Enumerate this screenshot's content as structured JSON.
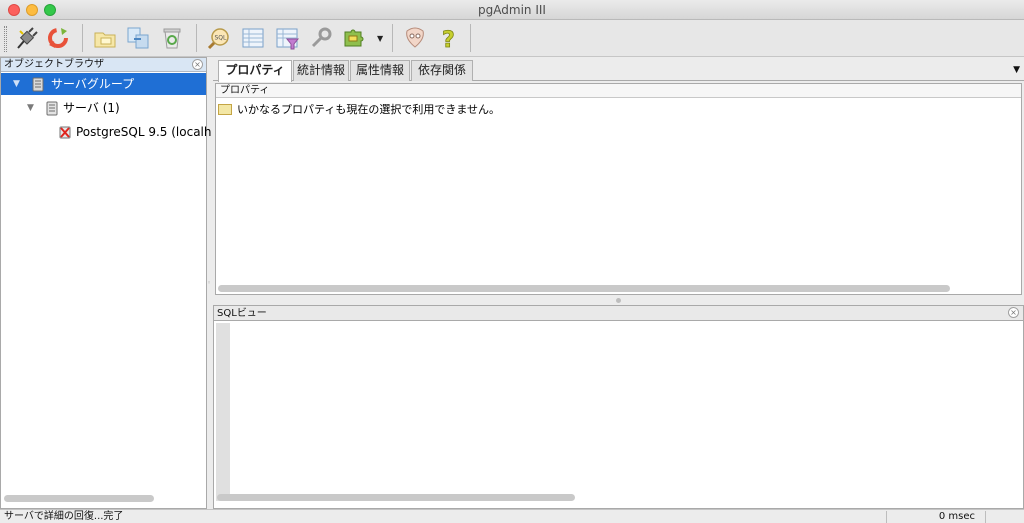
{
  "window": {
    "title": "pgAdmin III"
  },
  "toolbar": {
    "buttons": [
      {
        "icon": "connect-plug-icon"
      },
      {
        "icon": "refresh-icon"
      },
      {
        "icon": "properties-folder-icon"
      },
      {
        "icon": "create-object-icon"
      },
      {
        "icon": "drop-object-recycle-icon"
      },
      {
        "icon": "sql-query-icon"
      },
      {
        "icon": "view-data-grid-icon"
      },
      {
        "icon": "filtered-data-icon"
      },
      {
        "icon": "maintenance-wrench-icon"
      },
      {
        "icon": "plugins-puzzle-icon"
      },
      {
        "icon": "tips-icon"
      },
      {
        "icon": "help-question-icon"
      }
    ]
  },
  "object_browser": {
    "title": "オブジェクトブラウザ",
    "tree": [
      {
        "label": "サーバグループ",
        "icon": "server-group-icon",
        "selected": true
      },
      {
        "label": "サーバ (1)",
        "icon": "servers-icon",
        "selected": false
      },
      {
        "label": "PostgreSQL 9.5 (localh",
        "icon": "disconnected-server-icon",
        "selected": false
      }
    ]
  },
  "tabs": [
    {
      "label": "プロパティ",
      "active": true
    },
    {
      "label": "統計情報",
      "active": false
    },
    {
      "label": "属性情報",
      "active": false
    },
    {
      "label": "依存関係",
      "active": false
    }
  ],
  "properties": {
    "column_header": "プロパティ",
    "message": "いかなるプロパティも現在の選択で利用できません。"
  },
  "sql_view": {
    "title": "SQLビュー"
  },
  "status": {
    "message": "サーバで詳細の回復...完了",
    "timing": "0 msec"
  },
  "colors": {
    "selection": "#1f6fd5",
    "panel_header": "#d9e6f4"
  }
}
